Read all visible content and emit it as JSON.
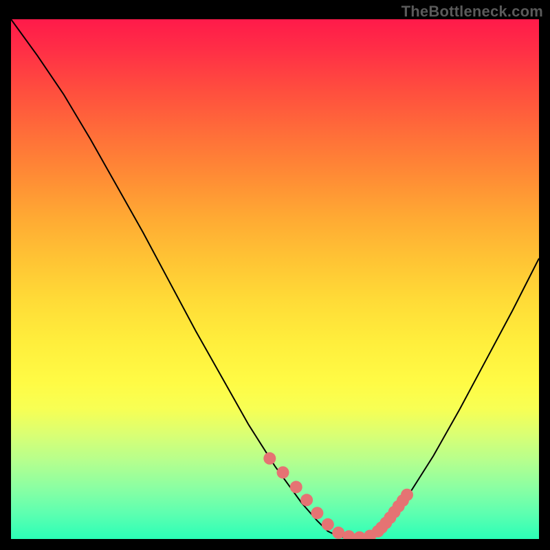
{
  "watermark": "TheBottleneck.com",
  "chart_data": {
    "type": "line",
    "title": "",
    "xlabel": "",
    "ylabel": "",
    "xlim": [
      0,
      100
    ],
    "ylim": [
      0,
      100
    ],
    "series": [
      {
        "name": "curve",
        "x": [
          0,
          5,
          10,
          15,
          20,
          25,
          30,
          35,
          40,
          45,
          50,
          55,
          58,
          60,
          62,
          65,
          68,
          70,
          75,
          80,
          85,
          90,
          95,
          100
        ],
        "y": [
          100,
          93,
          85.5,
          77,
          68,
          59,
          49.5,
          40,
          31,
          22,
          14,
          7,
          3.5,
          1.5,
          0.5,
          0,
          0.5,
          2,
          8,
          16,
          25,
          34.5,
          44,
          54
        ]
      }
    ],
    "markers": {
      "name": "highlight-dots",
      "x": [
        49,
        51.5,
        54,
        56,
        58,
        60,
        62,
        64,
        66,
        68,
        69.5,
        70.2,
        71,
        71.8,
        72.6,
        73.4,
        74.2,
        75
      ],
      "y": [
        15.5,
        12.8,
        10,
        7.5,
        5,
        2.8,
        1.2,
        0.5,
        0.3,
        0.6,
        1.5,
        2.2,
        3.1,
        4.1,
        5.2,
        6.3,
        7.4,
        8.5
      ]
    },
    "gradient_stops": [
      {
        "pos": 0.0,
        "color": "#ff1a4a"
      },
      {
        "pos": 0.35,
        "color": "#ff8b35"
      },
      {
        "pos": 0.65,
        "color": "#ffee3c"
      },
      {
        "pos": 1.0,
        "color": "#2bffb7"
      }
    ]
  }
}
